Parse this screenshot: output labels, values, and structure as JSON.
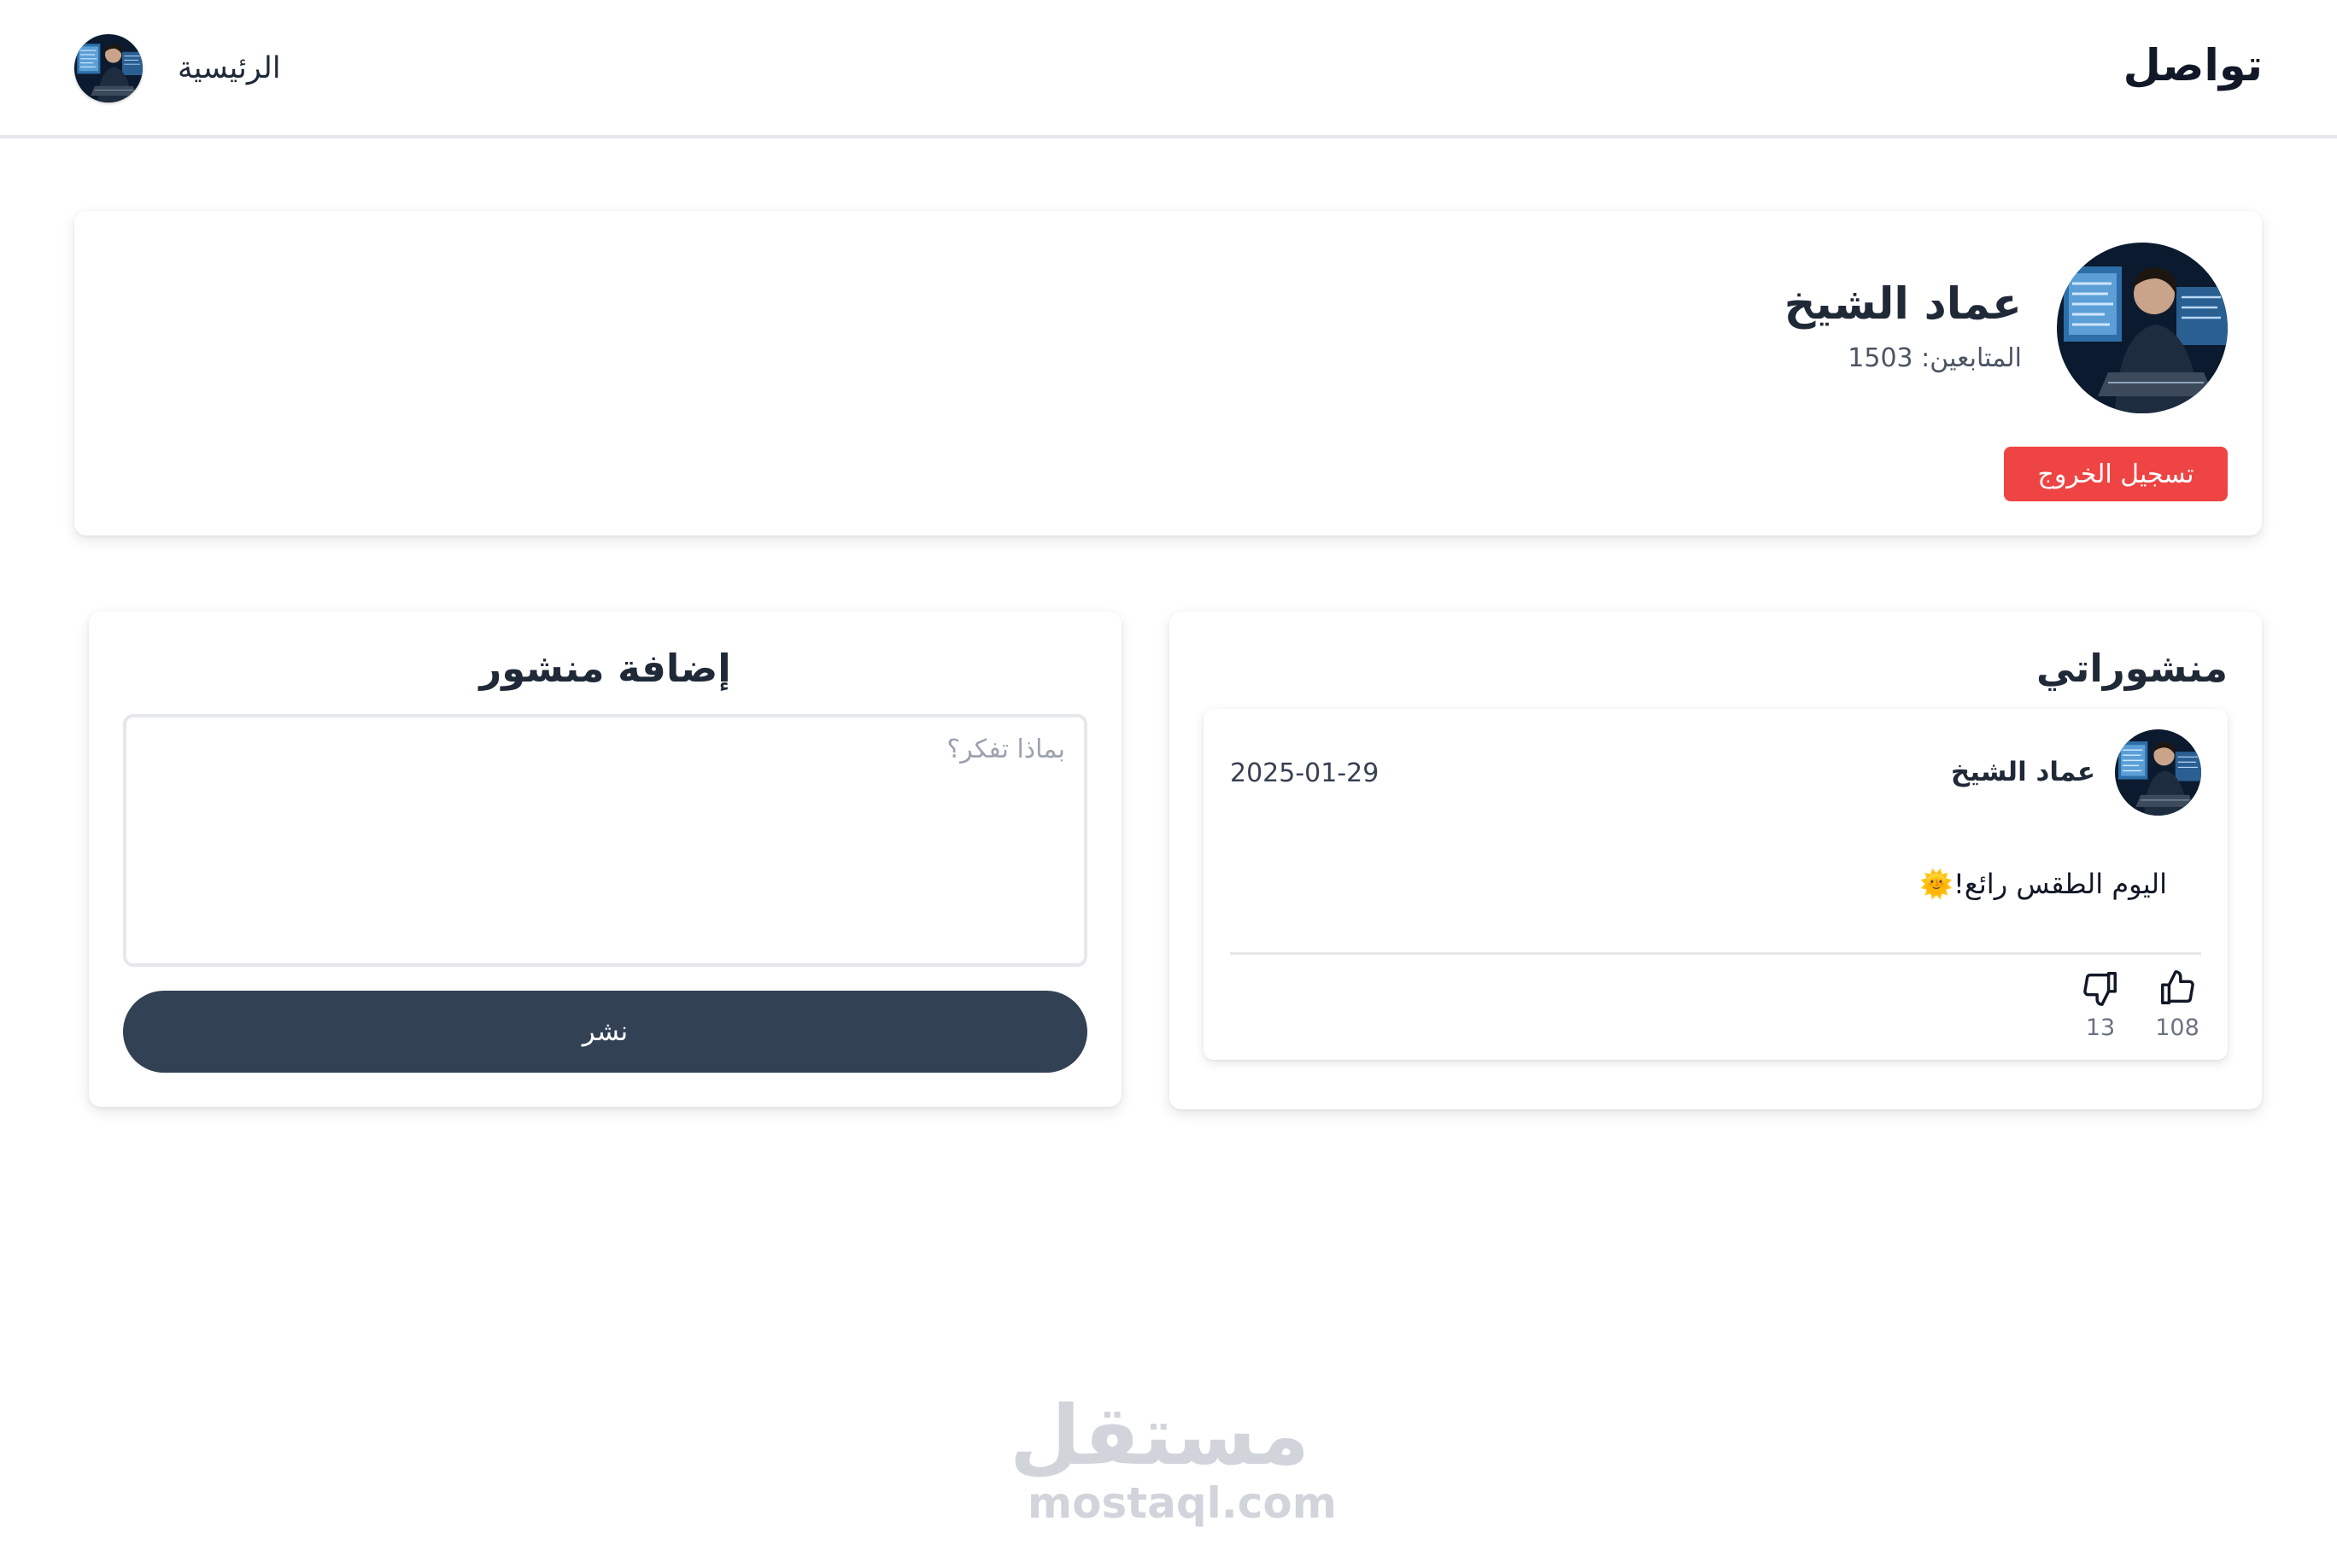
{
  "app": {
    "brand": "تواصل"
  },
  "nav": {
    "home_label": "الرئيسية",
    "avatar_icon": "user-avatar-icon"
  },
  "profile": {
    "name": "عماد الشيخ",
    "followers_label": "المتابعين: 1503",
    "logout_label": "تسجيل الخروج"
  },
  "posts_section": {
    "title": "منشوراتي",
    "posts": [
      {
        "author": "عماد الشيخ",
        "date": "2025-01-29",
        "text": "اليوم الطقس رائع!🌞",
        "likes": "108",
        "dislikes": "13"
      }
    ]
  },
  "add_post": {
    "title": "إضافة منشور",
    "placeholder": "بماذا تفكر؟",
    "value": "",
    "submit_label": "نشر"
  },
  "watermark": {
    "arabic": "مستقل",
    "latin": "mostaql.com"
  },
  "colors": {
    "accent_dark": "#334155",
    "danger": "#ef4444",
    "border": "#e5e7eb",
    "muted_text": "#6b7280"
  }
}
